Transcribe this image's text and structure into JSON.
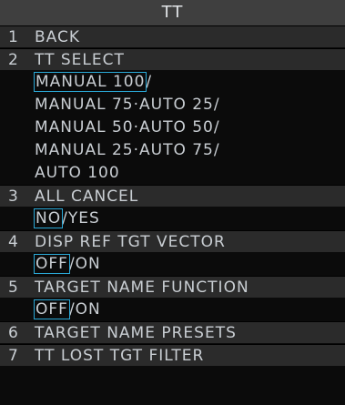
{
  "title": "TT",
  "items": [
    {
      "num": "1",
      "label": "BACK"
    },
    {
      "num": "2",
      "label": "TT SELECT"
    },
    {
      "num": "3",
      "label": "ALL CANCEL"
    },
    {
      "num": "4",
      "label": "DISP REF TGT VECTOR"
    },
    {
      "num": "5",
      "label": "TARGET NAME FUNCTION"
    },
    {
      "num": "6",
      "label": "TARGET NAME PRESETS"
    },
    {
      "num": "7",
      "label": "TT LOST TGT FILTER"
    }
  ],
  "tt_select": {
    "options": [
      "MANUAL 100",
      "MANUAL 75·AUTO 25",
      "MANUAL 50·AUTO 50",
      "MANUAL 25·AUTO 75",
      "AUTO 100"
    ],
    "selected": "MANUAL 100"
  },
  "all_cancel": {
    "options": [
      "NO",
      "YES"
    ],
    "selected": "NO"
  },
  "disp_ref_tgt_vector": {
    "options": [
      "OFF",
      "ON"
    ],
    "selected": "OFF"
  },
  "target_name_function": {
    "options": [
      "OFF",
      "ON"
    ],
    "selected": "OFF"
  },
  "separator": "/",
  "colors": {
    "background": "#0b0b0b",
    "title_bar": "#3f3f3f",
    "item_bar": "#2b2b2b",
    "text": "#c9ced3",
    "selection_outline": "#2aa8d6"
  }
}
